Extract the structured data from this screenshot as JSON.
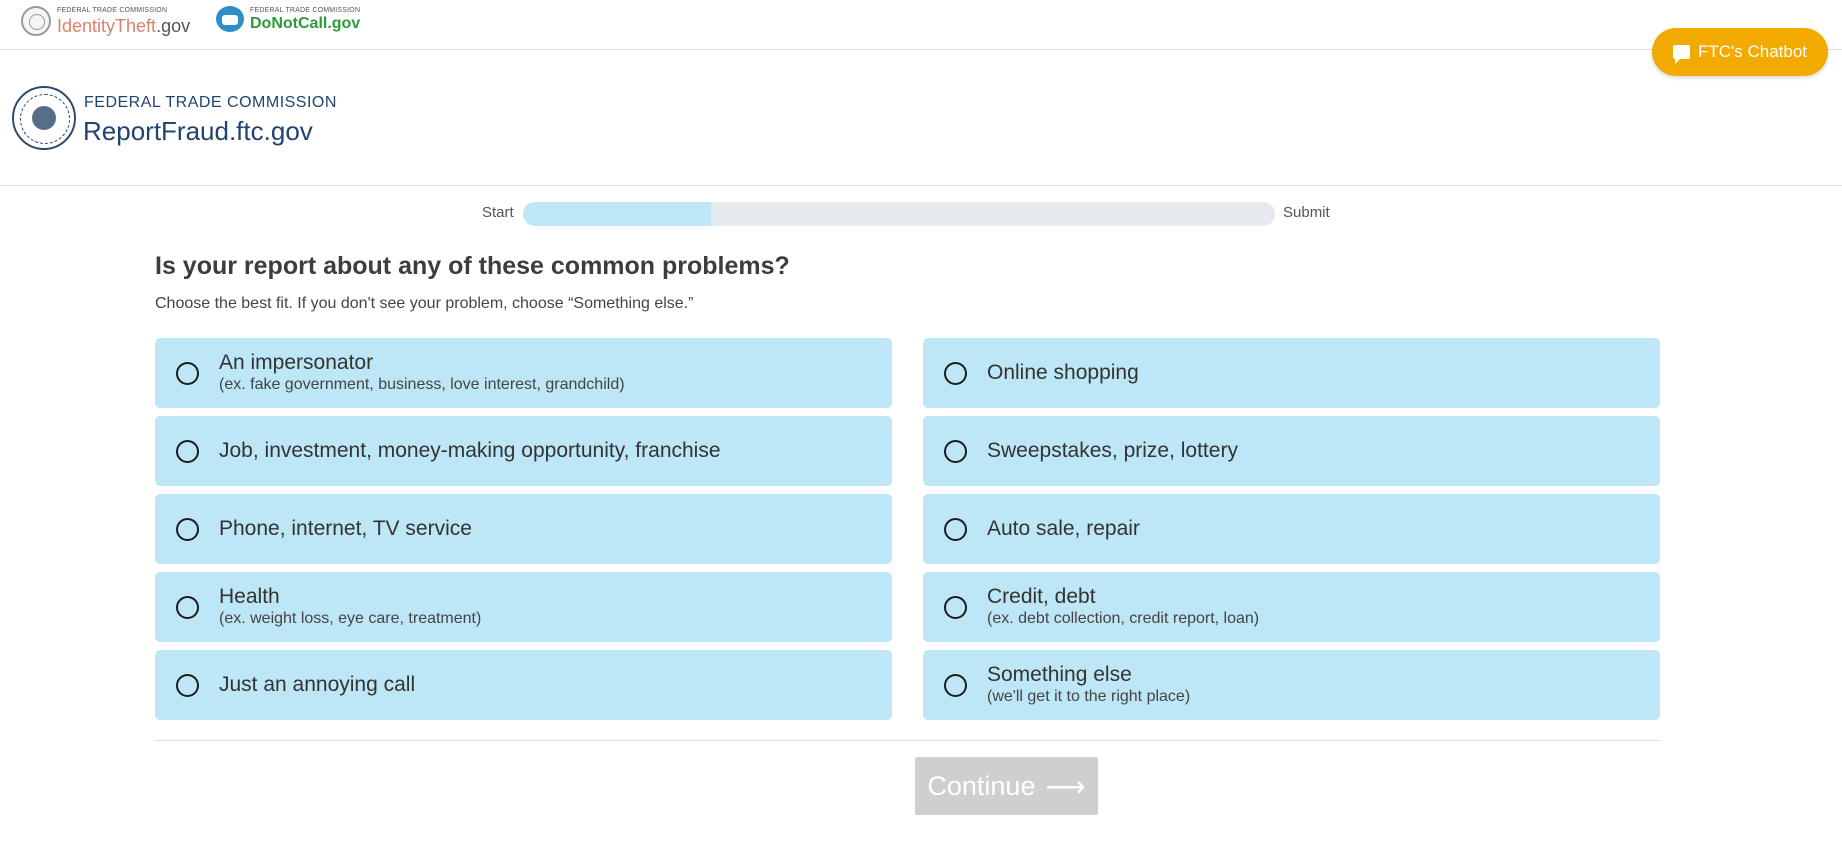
{
  "topbar": {
    "identitytheft": {
      "small": "Federal Trade Commission",
      "name": "IdentityTheft",
      "tld": ".gov"
    },
    "donotcall": {
      "small": "Federal Trade Commission",
      "name": "DoNotCall.gov"
    },
    "chatbot_label": "FTC's Chatbot"
  },
  "header": {
    "agency": "FEDERAL TRADE COMMISSION",
    "site": "ReportFraud.ftc.gov"
  },
  "progress": {
    "start_label": "Start",
    "end_label": "Submit",
    "fraction": 0.25
  },
  "question": {
    "title": "Is your report about any of these common problems?",
    "subtitle": "Choose the best fit. If you don't see your problem, choose “Something else.”"
  },
  "options": [
    {
      "label": "An impersonator",
      "sub": "(ex. fake government, business, love interest, grandchild)"
    },
    {
      "label": "Online shopping",
      "sub": ""
    },
    {
      "label": "Job, investment, money-making opportunity, franchise",
      "sub": ""
    },
    {
      "label": "Sweepstakes, prize, lottery",
      "sub": ""
    },
    {
      "label": "Phone, internet, TV service",
      "sub": ""
    },
    {
      "label": "Auto sale, repair",
      "sub": ""
    },
    {
      "label": "Health",
      "sub": "(ex. weight loss, eye care, treatment)"
    },
    {
      "label": "Credit, debt",
      "sub": "(ex. debt collection, credit report, loan)"
    },
    {
      "label": "Just an annoying call",
      "sub": ""
    },
    {
      "label": "Something else",
      "sub": "(we'll get it to the right place)"
    }
  ],
  "continue_label": "Continue",
  "colors": {
    "option_bg": "#bde6f6",
    "chatbot_bg": "#f2a900",
    "brand_navy": "#1f4470",
    "button_disabled": "#cfcfcf"
  }
}
